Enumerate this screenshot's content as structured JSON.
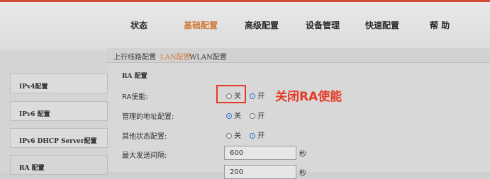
{
  "nav": {
    "items": [
      {
        "label": "状态"
      },
      {
        "label": "基础配置",
        "active": true
      },
      {
        "label": "高级配置"
      },
      {
        "label": "设备管理"
      },
      {
        "label": "快速配置"
      },
      {
        "label": "帮 助"
      }
    ]
  },
  "subnav": {
    "tabs": [
      {
        "label": "上行线路配置"
      },
      {
        "label": "LAN配置",
        "active": true
      },
      {
        "label": "WLAN配置"
      }
    ]
  },
  "sidebar": {
    "items": [
      {
        "label": "IPv4配置"
      },
      {
        "label": "IPv6 配置"
      },
      {
        "label": "IPv6 DHCP Server配置"
      },
      {
        "label": "RA 配置",
        "active": true
      }
    ]
  },
  "form": {
    "section_title": "RA 配置",
    "ra_enable": {
      "label": "RA使能:",
      "options": [
        "关",
        "开"
      ],
      "selected": "开"
    },
    "managed_flag": {
      "label": "管理的地址配置:",
      "options": [
        "关",
        "开"
      ],
      "selected": "关"
    },
    "other_flag": {
      "label": "其他状态配置:",
      "options": [
        "关",
        "开"
      ],
      "selected": "开"
    },
    "max_interval": {
      "label": "最大发送间隔:",
      "value": "600",
      "unit": "秒"
    },
    "min_interval": {
      "value": "200",
      "unit": "秒"
    }
  },
  "annotation": {
    "text": "关闭RA使能",
    "color": "#e43a24"
  },
  "colors": {
    "accent": "#d07a3a",
    "radio_selected": "#3b6bd0"
  }
}
